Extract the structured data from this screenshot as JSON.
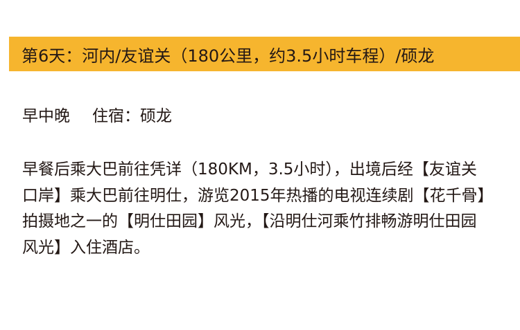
{
  "day": {
    "title": "第6天：河内/友谊关（180公里，约3.5小时车程）/硕龙",
    "accent_color": "#f6b52e"
  },
  "meals": {
    "label": "早中晚",
    "lodging": "住宿：硕龙"
  },
  "description": "早餐后乘大巴前往凭详（180KM，3.5小时），出境后经【友谊关口岸】乘大巴前往明仕，游览2015年热播的电视连续剧【花千骨】拍摄地之一的【明仕田园】风光，【沿明仕河乘竹排畅游明仕田园风光】入住酒店。"
}
